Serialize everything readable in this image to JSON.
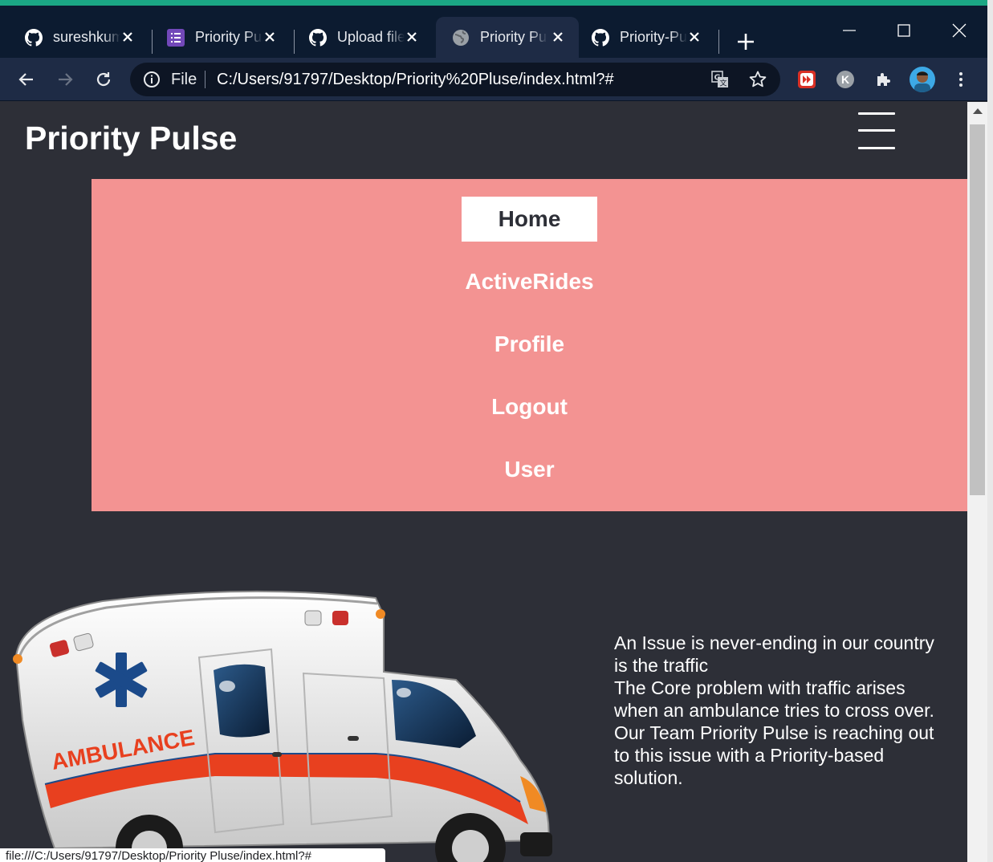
{
  "browser": {
    "tabs": [
      {
        "title": "sureshkumar",
        "icon": "github-icon",
        "active": false
      },
      {
        "title": "Priority Pulse",
        "icon": "forms-icon",
        "active": false
      },
      {
        "title": "Upload files",
        "icon": "github-icon",
        "active": false
      },
      {
        "title": "Priority Pulse",
        "icon": "globe-icon",
        "active": true
      },
      {
        "title": "Priority-Pulse",
        "icon": "github-icon",
        "active": false
      }
    ],
    "omnibox": {
      "scheme_label": "File",
      "url": "C:/Users/91797/Desktop/Priority%20Pluse/index.html?#"
    },
    "profile_initial": "K",
    "status_url": "file:///C:/Users/91797/Desktop/Priority Pluse/index.html?#"
  },
  "page": {
    "brand": "Priority Pulse",
    "menu": [
      {
        "label": "Home",
        "active": true
      },
      {
        "label": "ActiveRides",
        "active": false
      },
      {
        "label": "Profile",
        "active": false
      },
      {
        "label": "Logout",
        "active": false
      },
      {
        "label": "User",
        "active": false
      }
    ],
    "hero": {
      "line1": "An Issue is never-ending in our country is the traffic",
      "line2": "The Core problem with traffic arises when an ambulance tries to cross over.",
      "line3": "Our Team Priority Pulse is reaching out to this issue with a Priority-based solution.",
      "image_text": "AMBULANCE"
    }
  },
  "colors": {
    "page_bg": "#2d2f37",
    "menu_bg": "#f39392",
    "titlebar": "#0c1b30",
    "toolbar": "#1e2b45",
    "accent": "#1ba784"
  }
}
